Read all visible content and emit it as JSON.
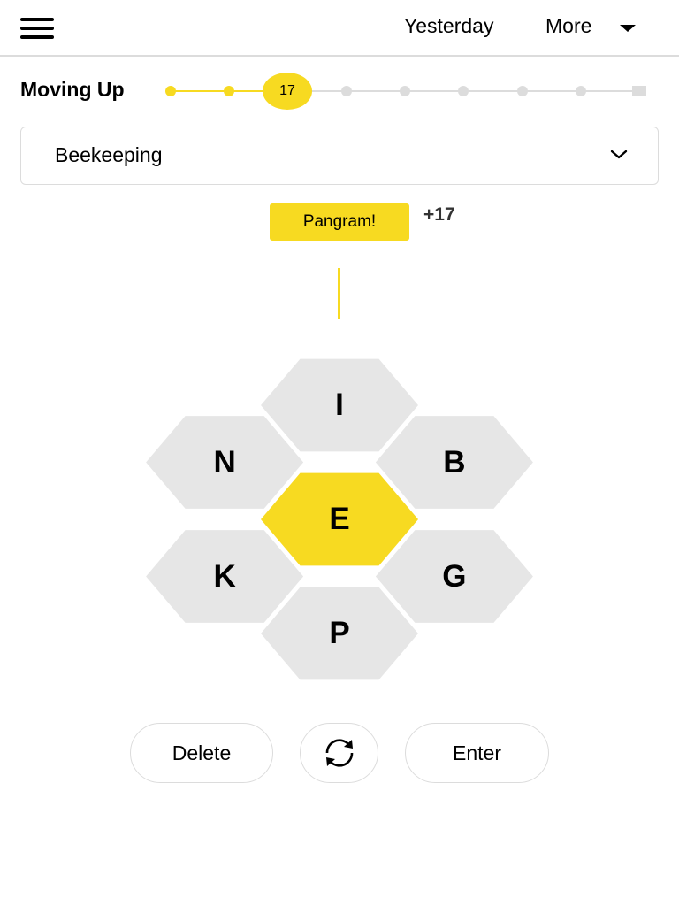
{
  "header": {
    "menu_icon": "hamburger-menu-icon",
    "yesterday_label": "Yesterday",
    "more_label": "More",
    "more_icon": "caret-down-icon"
  },
  "progress": {
    "rank": "Moving Up",
    "score": "17",
    "total_steps": 9,
    "current_step": 3,
    "accent_color": "#f7da21",
    "inactive_color": "#dcdcdc"
  },
  "wordlist": {
    "found_words_preview": "Beekeeping",
    "chevron_icon": "chevron-down-icon"
  },
  "message": {
    "badge": "Pangram!",
    "points": "+17"
  },
  "hive": {
    "center": "E",
    "outer": [
      "I",
      "B",
      "G",
      "P",
      "K",
      "N"
    ],
    "center_color": "#f7da21",
    "outer_color": "#e6e6e6"
  },
  "actions": {
    "delete_label": "Delete",
    "shuffle_icon": "shuffle-icon",
    "enter_label": "Enter"
  }
}
